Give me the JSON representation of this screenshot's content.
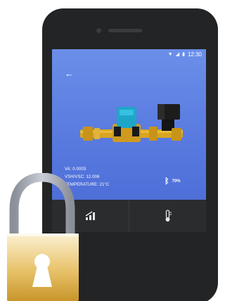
{
  "status_bar": {
    "wifi_icon": "wifi-icon",
    "signal_icon": "signal-icon",
    "battery_icon": "battery-icon",
    "time": "12:30"
  },
  "header": {
    "back_icon": "arrow-left-icon"
  },
  "device_image": "water-meter-with-valve",
  "readings": {
    "va": "VA: 0.0003",
    "vsh": "VSH/VSC: 12.006",
    "temperature": "TEMPERATURE: 21°C"
  },
  "bluetooth": {
    "icon": "bluetooth-icon",
    "percent": "70%"
  },
  "tabbar": {
    "tabs": [
      {
        "icon": "signal-bars-icon"
      },
      {
        "icon": "thermometer-icon"
      }
    ]
  },
  "overlay": {
    "icon": "padlock-icon"
  },
  "colors": {
    "screen_top": "#6b8fe9",
    "screen_bottom": "#4e6fd8",
    "phone_body": "#232425",
    "meter_body": "#1ea6c9",
    "brass": "#d9a521",
    "lock_gold": "#d8a93a"
  }
}
